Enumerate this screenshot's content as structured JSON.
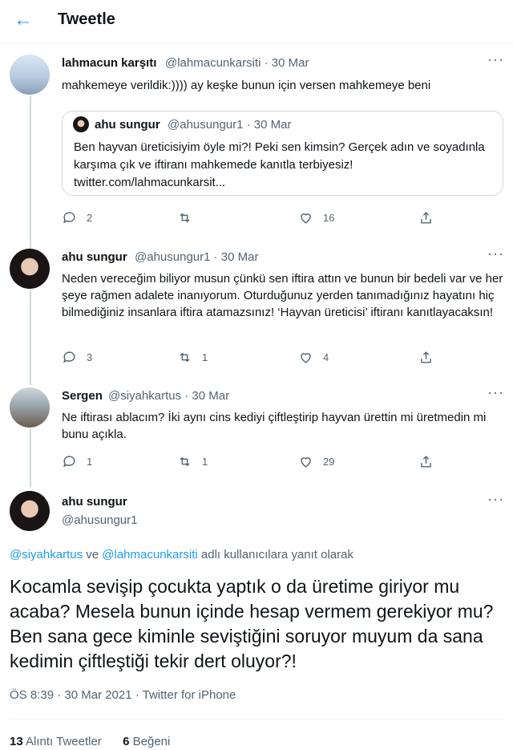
{
  "header": {
    "title": "Tweetle"
  },
  "tweets": [
    {
      "name": "lahmacun karşıtı",
      "meta": "@lahmacunkarsiti · 30 Mar",
      "text": "mahkemeye verildik:)))) ay keşke bunun için versen mahkemeye beni",
      "quote": {
        "name": "ahu sungur",
        "meta": "@ahusungur1 · 30 Mar",
        "text": "Ben hayvan üreticisiyim öyle mi?! Peki sen kimsin? Gerçek adın ve soyadınla karşıma çık ve iftiranı mahkemede kanıtla terbiyesiz! twitter.com/lahmacunkarsit..."
      },
      "replies": "2",
      "retweets": "",
      "likes": "16"
    },
    {
      "name": "ahu sungur",
      "meta": "@ahusungur1 · 30 Mar",
      "text": "Neden vereceğim biliyor musun çünkü sen iftira attın ve bunun bir bedeli var ve her şeye rağmen adalete inanıyorum. Oturduğunuz yerden tanımadığınız hayatını hiç bilmediğiniz insanlara iftira atamazsınız! ‘Hayvan üreticisi’ iftiranı kanıtlayacaksın!",
      "replies": "3",
      "retweets": "1",
      "likes": "4"
    },
    {
      "name": "Sergen",
      "meta": "@siyahkartus · 30 Mar",
      "text": "Ne iftirası ablacım? İki aynı cins kediyi çiftleştirip hayvan ürettin mi üretmedin mi bunu açıkla.",
      "replies": "1",
      "retweets": "1",
      "likes": "29"
    }
  ],
  "main": {
    "name": "ahu sungur",
    "handle": "@ahusungur1",
    "reply_to_1": "@siyahkartus",
    "reply_to_and": " ve ",
    "reply_to_2": "@lahmacunkarsiti",
    "reply_to_suffix": " adlı kullanıcılara yanıt olarak",
    "text": "Kocamla sevişip çocukta yaptık o da üretime giriyor mu acaba? Mesela bunun içinde hesap vermem gerekiyor mu? Ben sana gece kiminle seviştiğini soruyor muyum da sana kedimin  çiftleştiği tekir dert oluyor?!",
    "timestamp": "ÖS 8:39 · 30 Mar 2021 · Twitter for iPhone",
    "quote_count": "13",
    "quote_label": " Alıntı Tweetler",
    "like_count": "6",
    "like_label": " Beğeni"
  },
  "icons": {
    "accent": "#1d9bf0",
    "muted": "#536471"
  }
}
